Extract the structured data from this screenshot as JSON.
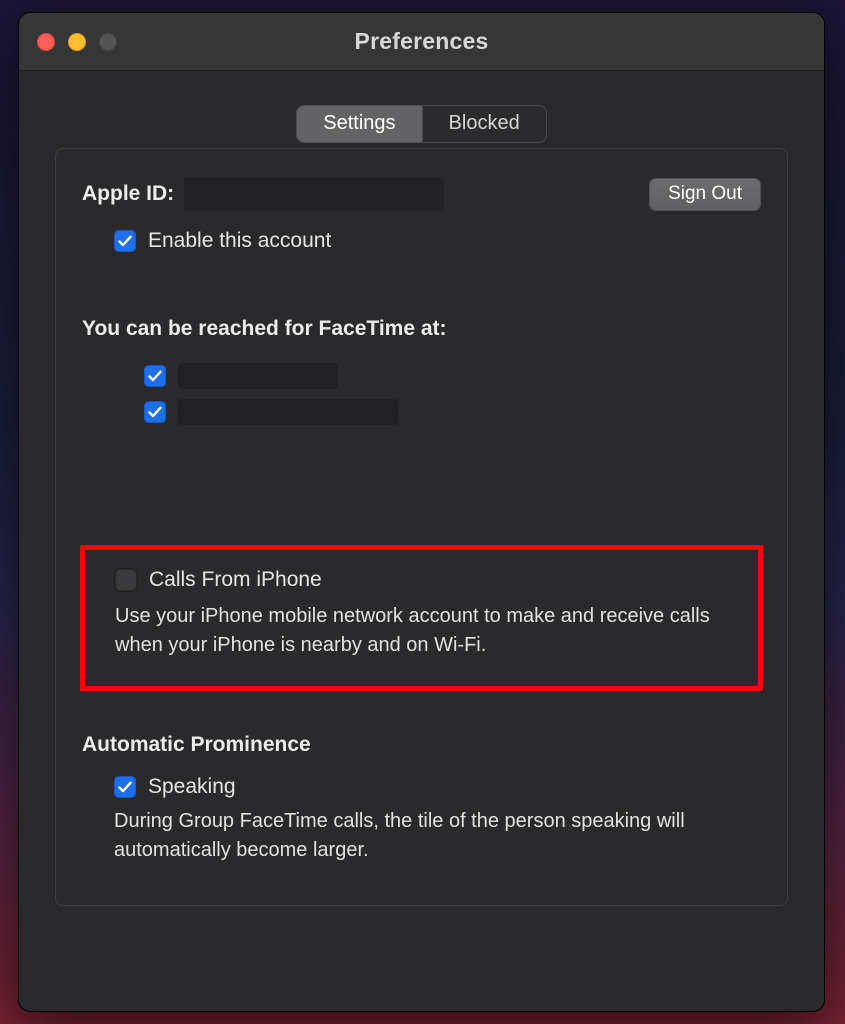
{
  "window": {
    "title": "Preferences"
  },
  "tabs": {
    "settings": "Settings",
    "blocked": "Blocked",
    "active": "settings"
  },
  "appleId": {
    "label": "Apple ID:",
    "signOut": "Sign Out",
    "enableLabel": "Enable this account",
    "enableChecked": true
  },
  "reach": {
    "heading": "You can be reached for FaceTime at:",
    "items": [
      {
        "checked": true
      },
      {
        "checked": true
      }
    ]
  },
  "callsFromIphone": {
    "label": "Calls From iPhone",
    "checked": false,
    "description": "Use your iPhone mobile network account to make and receive calls when your iPhone is nearby and on Wi-Fi."
  },
  "autoProminence": {
    "heading": "Automatic Prominence",
    "speakingLabel": "Speaking",
    "speakingChecked": true,
    "description": "During Group FaceTime calls, the tile of the person speaking will automatically become larger."
  }
}
